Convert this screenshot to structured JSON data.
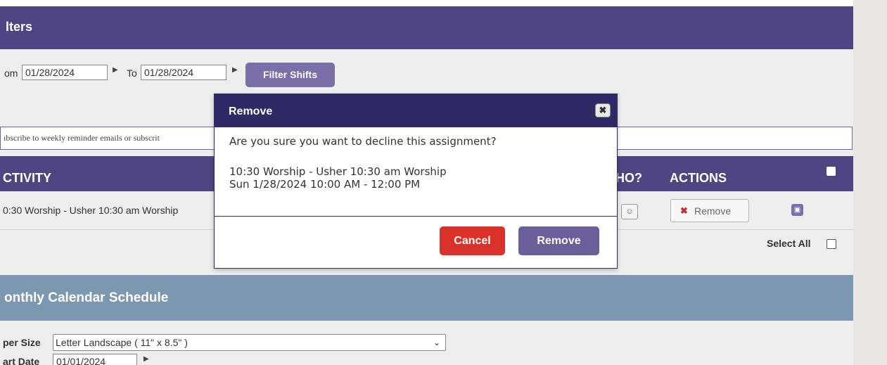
{
  "filters": {
    "title": "lters",
    "from_label": "om",
    "from_value": "01/28/2024",
    "to_label": "To",
    "to_value": "01/28/2024",
    "filter_button": "Filter Shifts",
    "flag_icon": "▶"
  },
  "subscribe": {
    "text": "ıbscribe to weekly reminder emails or subscrit"
  },
  "table": {
    "headers": [
      "CTIVITY",
      "/HO?",
      "ACTIONS"
    ],
    "rows": [
      {
        "activity": "0:30 Worship - Usher 10:30 am Worship",
        "action": "Remove"
      }
    ],
    "select_all": "Select All"
  },
  "monthly": {
    "title": "onthly Calendar Schedule",
    "paper_label": "per Size",
    "paper_value": "Letter Landscape ( 11\" x 8.5\" )",
    "start_label": "art Date",
    "start_value": "01/01/2024"
  },
  "modal": {
    "title": "Remove",
    "close_icon": "✖",
    "question": "Are you sure you want to decline this assignment?",
    "line1": "10:30 Worship - Usher 10:30 am Worship",
    "line2": "Sun 1/28/2024 10:00 AM - 12:00 PM",
    "cancel_label": "Cancel",
    "remove_label": "Remove"
  },
  "colors": {
    "header_purple": "#4f4583",
    "modal_header": "#2f2965",
    "cancel_red": "#d9322a",
    "remove_purple": "#6b5f99",
    "calendar_header": "#7c98b0"
  }
}
